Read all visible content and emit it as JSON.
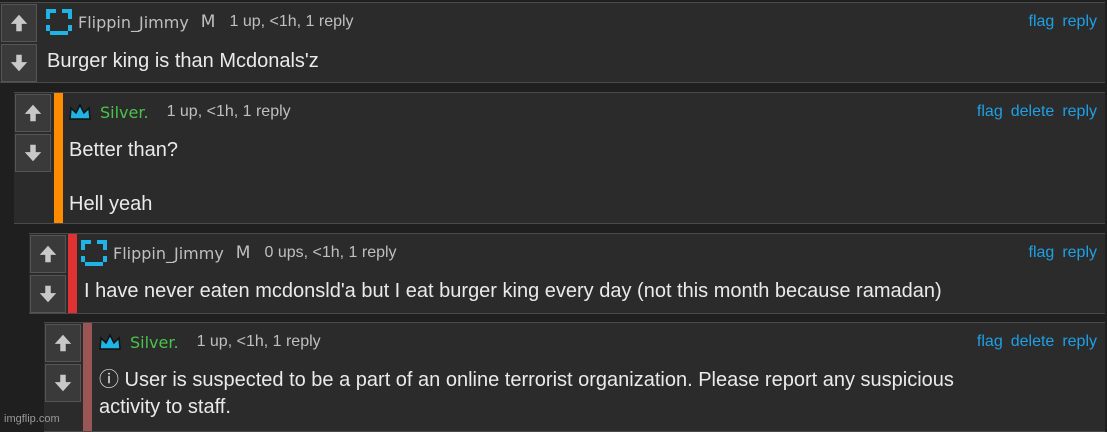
{
  "comments": [
    {
      "username": "Flippin_Jimmy",
      "mod_tag": "M",
      "meta": "1 up, <1h, 1 reply",
      "actions": {
        "flag": "flag",
        "reply": "reply"
      },
      "text": "Burger king is than Mcdonals'z"
    },
    {
      "username": "Silver.",
      "meta": "1 up, <1h, 1 reply",
      "accent_color": "#ff8c00",
      "actions": {
        "flag": "flag",
        "delete": "delete",
        "reply": "reply"
      },
      "text_lines": [
        "Better than?",
        "Hell yeah"
      ]
    },
    {
      "username": "Flippin_Jimmy",
      "mod_tag": "M",
      "meta": "0 ups, <1h, 1 reply",
      "accent_color": "#e03232",
      "actions": {
        "flag": "flag",
        "reply": "reply"
      },
      "text": "I have never eaten mcdonsld'a but I eat burger king every day (not this month because ramadan)"
    },
    {
      "username": "Silver.",
      "meta": "1 up, <1h, 1 reply",
      "accent_color": "#9a5555",
      "actions": {
        "flag": "flag",
        "delete": "delete",
        "reply": "reply"
      },
      "text_lines": [
        "ⓘ User is suspected to be a part of an online terrorist organization. Please report any suspicious",
        "activity to staff."
      ]
    }
  ],
  "icons": {
    "upvote": "arrow-up-icon",
    "downvote": "arrow-down-icon",
    "jimmy_avatar": "pixel-smiley-icon",
    "silver_badge": "crown-icon"
  },
  "colors": {
    "background": "#1f1f1f",
    "card": "#2b2b2b",
    "link": "#1ea0e6",
    "silver_name": "#4cc24c"
  },
  "watermark": "imgflip.com"
}
